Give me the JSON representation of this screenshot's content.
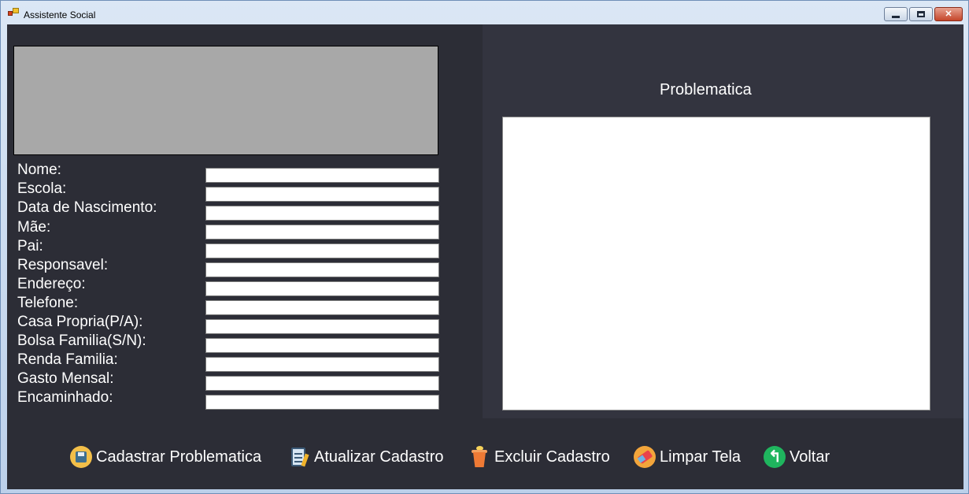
{
  "window": {
    "title": "Assistente Social",
    "controls": {
      "minimize": "minimize",
      "maximize": "maximize",
      "close": "✕"
    }
  },
  "form": {
    "fields": [
      {
        "label": "Nome:",
        "value": ""
      },
      {
        "label": "Escola:",
        "value": ""
      },
      {
        "label": "Data de Nascimento:",
        "value": ""
      },
      {
        "label": "Mãe:",
        "value": ""
      },
      {
        "label": "Pai:",
        "value": ""
      },
      {
        "label": "Responsavel:",
        "value": ""
      },
      {
        "label": "Endereço:",
        "value": ""
      },
      {
        "label": "Telefone:",
        "value": ""
      },
      {
        "label": "Casa Propria(P/A):",
        "value": ""
      },
      {
        "label": "Bolsa Familia(S/N):",
        "value": ""
      },
      {
        "label": "Renda Familia:",
        "value": ""
      },
      {
        "label": "Gasto Mensal:",
        "value": ""
      },
      {
        "label": "Encaminhado:",
        "value": ""
      }
    ]
  },
  "problematica": {
    "title": "Problematica",
    "text": ""
  },
  "buttons": {
    "cadastrar": "Cadastrar Problematica",
    "atualizar": "Atualizar Cadastro",
    "excluir": "Excluir Cadastro",
    "limpar": "Limpar Tela",
    "voltar": "Voltar"
  },
  "icons": {
    "cadastrar": "floppy-disk-icon",
    "atualizar": "clipboard-pencil-icon",
    "excluir": "trash-bin-icon",
    "limpar": "eraser-icon",
    "voltar": "back-arrow-icon"
  },
  "colors": {
    "background": "#2c2d36",
    "right_panel": "#33343f",
    "photo": "#a8a8a8",
    "text": "#ffffff"
  }
}
